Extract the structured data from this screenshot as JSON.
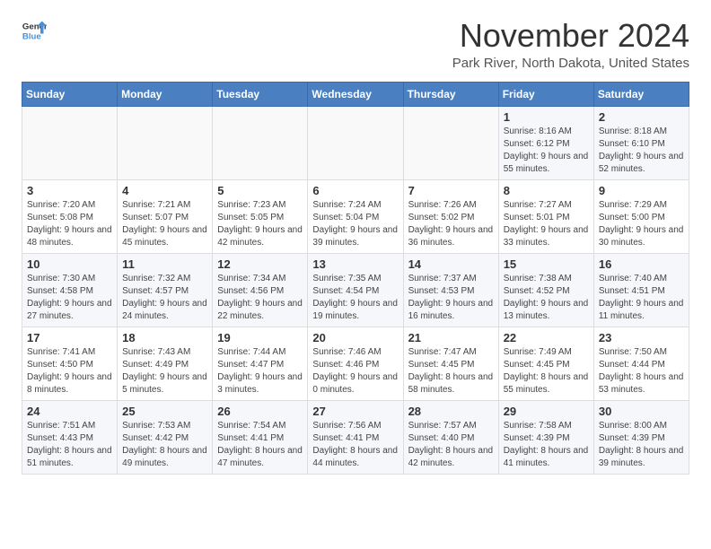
{
  "header": {
    "logo_general": "General",
    "logo_blue": "Blue",
    "month_title": "November 2024",
    "location": "Park River, North Dakota, United States"
  },
  "days_of_week": [
    "Sunday",
    "Monday",
    "Tuesday",
    "Wednesday",
    "Thursday",
    "Friday",
    "Saturday"
  ],
  "weeks": [
    [
      {
        "day": "",
        "info": ""
      },
      {
        "day": "",
        "info": ""
      },
      {
        "day": "",
        "info": ""
      },
      {
        "day": "",
        "info": ""
      },
      {
        "day": "",
        "info": ""
      },
      {
        "day": "1",
        "info": "Sunrise: 8:16 AM\nSunset: 6:12 PM\nDaylight: 9 hours and 55 minutes."
      },
      {
        "day": "2",
        "info": "Sunrise: 8:18 AM\nSunset: 6:10 PM\nDaylight: 9 hours and 52 minutes."
      }
    ],
    [
      {
        "day": "3",
        "info": "Sunrise: 7:20 AM\nSunset: 5:08 PM\nDaylight: 9 hours and 48 minutes."
      },
      {
        "day": "4",
        "info": "Sunrise: 7:21 AM\nSunset: 5:07 PM\nDaylight: 9 hours and 45 minutes."
      },
      {
        "day": "5",
        "info": "Sunrise: 7:23 AM\nSunset: 5:05 PM\nDaylight: 9 hours and 42 minutes."
      },
      {
        "day": "6",
        "info": "Sunrise: 7:24 AM\nSunset: 5:04 PM\nDaylight: 9 hours and 39 minutes."
      },
      {
        "day": "7",
        "info": "Sunrise: 7:26 AM\nSunset: 5:02 PM\nDaylight: 9 hours and 36 minutes."
      },
      {
        "day": "8",
        "info": "Sunrise: 7:27 AM\nSunset: 5:01 PM\nDaylight: 9 hours and 33 minutes."
      },
      {
        "day": "9",
        "info": "Sunrise: 7:29 AM\nSunset: 5:00 PM\nDaylight: 9 hours and 30 minutes."
      }
    ],
    [
      {
        "day": "10",
        "info": "Sunrise: 7:30 AM\nSunset: 4:58 PM\nDaylight: 9 hours and 27 minutes."
      },
      {
        "day": "11",
        "info": "Sunrise: 7:32 AM\nSunset: 4:57 PM\nDaylight: 9 hours and 24 minutes."
      },
      {
        "day": "12",
        "info": "Sunrise: 7:34 AM\nSunset: 4:56 PM\nDaylight: 9 hours and 22 minutes."
      },
      {
        "day": "13",
        "info": "Sunrise: 7:35 AM\nSunset: 4:54 PM\nDaylight: 9 hours and 19 minutes."
      },
      {
        "day": "14",
        "info": "Sunrise: 7:37 AM\nSunset: 4:53 PM\nDaylight: 9 hours and 16 minutes."
      },
      {
        "day": "15",
        "info": "Sunrise: 7:38 AM\nSunset: 4:52 PM\nDaylight: 9 hours and 13 minutes."
      },
      {
        "day": "16",
        "info": "Sunrise: 7:40 AM\nSunset: 4:51 PM\nDaylight: 9 hours and 11 minutes."
      }
    ],
    [
      {
        "day": "17",
        "info": "Sunrise: 7:41 AM\nSunset: 4:50 PM\nDaylight: 9 hours and 8 minutes."
      },
      {
        "day": "18",
        "info": "Sunrise: 7:43 AM\nSunset: 4:49 PM\nDaylight: 9 hours and 5 minutes."
      },
      {
        "day": "19",
        "info": "Sunrise: 7:44 AM\nSunset: 4:47 PM\nDaylight: 9 hours and 3 minutes."
      },
      {
        "day": "20",
        "info": "Sunrise: 7:46 AM\nSunset: 4:46 PM\nDaylight: 9 hours and 0 minutes."
      },
      {
        "day": "21",
        "info": "Sunrise: 7:47 AM\nSunset: 4:45 PM\nDaylight: 8 hours and 58 minutes."
      },
      {
        "day": "22",
        "info": "Sunrise: 7:49 AM\nSunset: 4:45 PM\nDaylight: 8 hours and 55 minutes."
      },
      {
        "day": "23",
        "info": "Sunrise: 7:50 AM\nSunset: 4:44 PM\nDaylight: 8 hours and 53 minutes."
      }
    ],
    [
      {
        "day": "24",
        "info": "Sunrise: 7:51 AM\nSunset: 4:43 PM\nDaylight: 8 hours and 51 minutes."
      },
      {
        "day": "25",
        "info": "Sunrise: 7:53 AM\nSunset: 4:42 PM\nDaylight: 8 hours and 49 minutes."
      },
      {
        "day": "26",
        "info": "Sunrise: 7:54 AM\nSunset: 4:41 PM\nDaylight: 8 hours and 47 minutes."
      },
      {
        "day": "27",
        "info": "Sunrise: 7:56 AM\nSunset: 4:41 PM\nDaylight: 8 hours and 44 minutes."
      },
      {
        "day": "28",
        "info": "Sunrise: 7:57 AM\nSunset: 4:40 PM\nDaylight: 8 hours and 42 minutes."
      },
      {
        "day": "29",
        "info": "Sunrise: 7:58 AM\nSunset: 4:39 PM\nDaylight: 8 hours and 41 minutes."
      },
      {
        "day": "30",
        "info": "Sunrise: 8:00 AM\nSunset: 4:39 PM\nDaylight: 8 hours and 39 minutes."
      }
    ]
  ]
}
